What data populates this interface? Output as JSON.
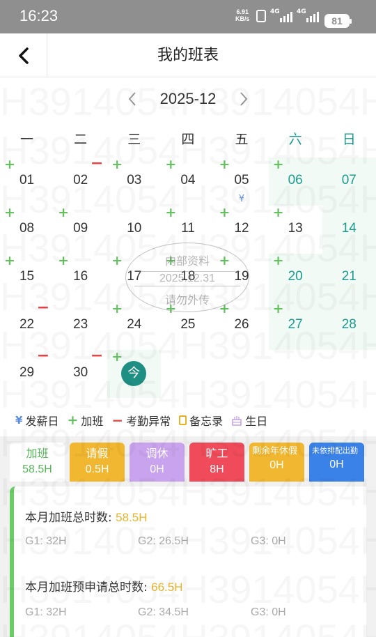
{
  "status": {
    "time": "16:23",
    "net_speed_value": "6.91",
    "net_speed_unit": "KB/s",
    "signal_label_1": "4G",
    "signal_label_2": "4G",
    "battery": "81"
  },
  "header": {
    "title": "我的班表"
  },
  "month_nav": {
    "current": "2025-12"
  },
  "weekdays": [
    "一",
    "二",
    "三",
    "四",
    "五",
    "六",
    "日"
  ],
  "calendar": {
    "weeks": [
      [
        {
          "day": "01",
          "plus": true,
          "minus": false
        },
        {
          "day": "02",
          "plus": false,
          "minus": true
        },
        {
          "day": "03",
          "plus": true,
          "minus": false
        },
        {
          "day": "04",
          "plus": true,
          "minus": false
        },
        {
          "day": "05",
          "plus": true,
          "minus": false,
          "payday": true
        },
        {
          "day": "06",
          "plus": true,
          "minus": false,
          "weekend": true,
          "shaded": true
        },
        {
          "day": "07",
          "plus": false,
          "minus": false,
          "weekend": true,
          "shaded": true
        }
      ],
      [
        {
          "day": "08",
          "plus": true,
          "minus": false
        },
        {
          "day": "09",
          "plus": true,
          "minus": false
        },
        {
          "day": "10",
          "plus": false,
          "minus": false
        },
        {
          "day": "11",
          "plus": true,
          "minus": false
        },
        {
          "day": "12",
          "plus": true,
          "minus": false
        },
        {
          "day": "13",
          "plus": true,
          "minus": false,
          "weekend": false
        },
        {
          "day": "14",
          "plus": false,
          "minus": false,
          "weekend": true,
          "shaded": true
        }
      ],
      [
        {
          "day": "15",
          "plus": true,
          "minus": false
        },
        {
          "day": "16",
          "plus": true,
          "minus": false
        },
        {
          "day": "17",
          "plus": true,
          "minus": false
        },
        {
          "day": "18",
          "plus": true,
          "minus": false
        },
        {
          "day": "19",
          "plus": true,
          "minus": false
        },
        {
          "day": "20",
          "plus": true,
          "minus": false,
          "weekend": true,
          "shaded": true
        },
        {
          "day": "21",
          "plus": false,
          "minus": false,
          "weekend": true,
          "shaded": true
        }
      ],
      [
        {
          "day": "22",
          "plus": false,
          "minus": true
        },
        {
          "day": "23",
          "plus": false,
          "minus": false
        },
        {
          "day": "24",
          "plus": true,
          "minus": false
        },
        {
          "day": "25",
          "plus": true,
          "minus": false
        },
        {
          "day": "26",
          "plus": true,
          "minus": false
        },
        {
          "day": "27",
          "plus": true,
          "minus": false,
          "weekend": true,
          "shaded": true
        },
        {
          "day": "28",
          "plus": false,
          "minus": false,
          "weekend": true,
          "shaded": true
        }
      ],
      [
        {
          "day": "29",
          "plus": false,
          "minus": true
        },
        {
          "day": "30",
          "plus": false,
          "minus": true
        },
        {
          "day": "今",
          "plus": true,
          "minus": false,
          "today": true,
          "shaded": true
        },
        {
          "day": "",
          "empty": true
        },
        {
          "day": "",
          "empty": true
        },
        {
          "day": "",
          "empty": true
        },
        {
          "day": "",
          "empty": true
        }
      ]
    ],
    "payday_symbol": "¥"
  },
  "stamp": {
    "line1": "内部资料",
    "line2": "2025.12.31",
    "line3": "请勿外传"
  },
  "legend": [
    {
      "icon": "yen-icon",
      "symbol": "¥",
      "label": "发薪日",
      "color": "#5b8de0"
    },
    {
      "icon": "plus-icon",
      "symbol": "+",
      "label": "加班",
      "color": "#65c160"
    },
    {
      "icon": "minus-icon",
      "symbol": "−",
      "label": "考勤异常",
      "color": "#e64545"
    },
    {
      "icon": "memo-icon",
      "symbol": "",
      "label": "备忘录",
      "color": "#e8b225"
    },
    {
      "icon": "cake-icon",
      "symbol": "",
      "label": "生日",
      "color": "#c7a5ea"
    }
  ],
  "tabs": [
    {
      "title": "加班",
      "value": "58.5H",
      "color": "#ffffff",
      "active": true
    },
    {
      "title": "请假",
      "value": "0.5H",
      "color": "#f2b730"
    },
    {
      "title": "调休",
      "value": "0H",
      "color": "#c9a3ed"
    },
    {
      "title": "旷工",
      "value": "8H",
      "color": "#ef4b5a"
    },
    {
      "title": "剩余年休假",
      "value": "0H",
      "color": "#f2b730",
      "small": true
    },
    {
      "title": "未依排配出勤",
      "value": "0H",
      "color": "#3b82e8",
      "tiny": true
    }
  ],
  "panel": {
    "overtime_total_label": "本月加班总时数: ",
    "overtime_total_value": "58.5H",
    "overtime_groups": [
      "G1: 32H",
      "G2: 26.5H",
      "G3: 0H"
    ],
    "preapply_total_label": "本月加班预申请总时数: ",
    "preapply_total_value": "66.5H",
    "preapply_groups": [
      "G1: 32H",
      "G2: 34.5H",
      "G3: 0H"
    ]
  }
}
